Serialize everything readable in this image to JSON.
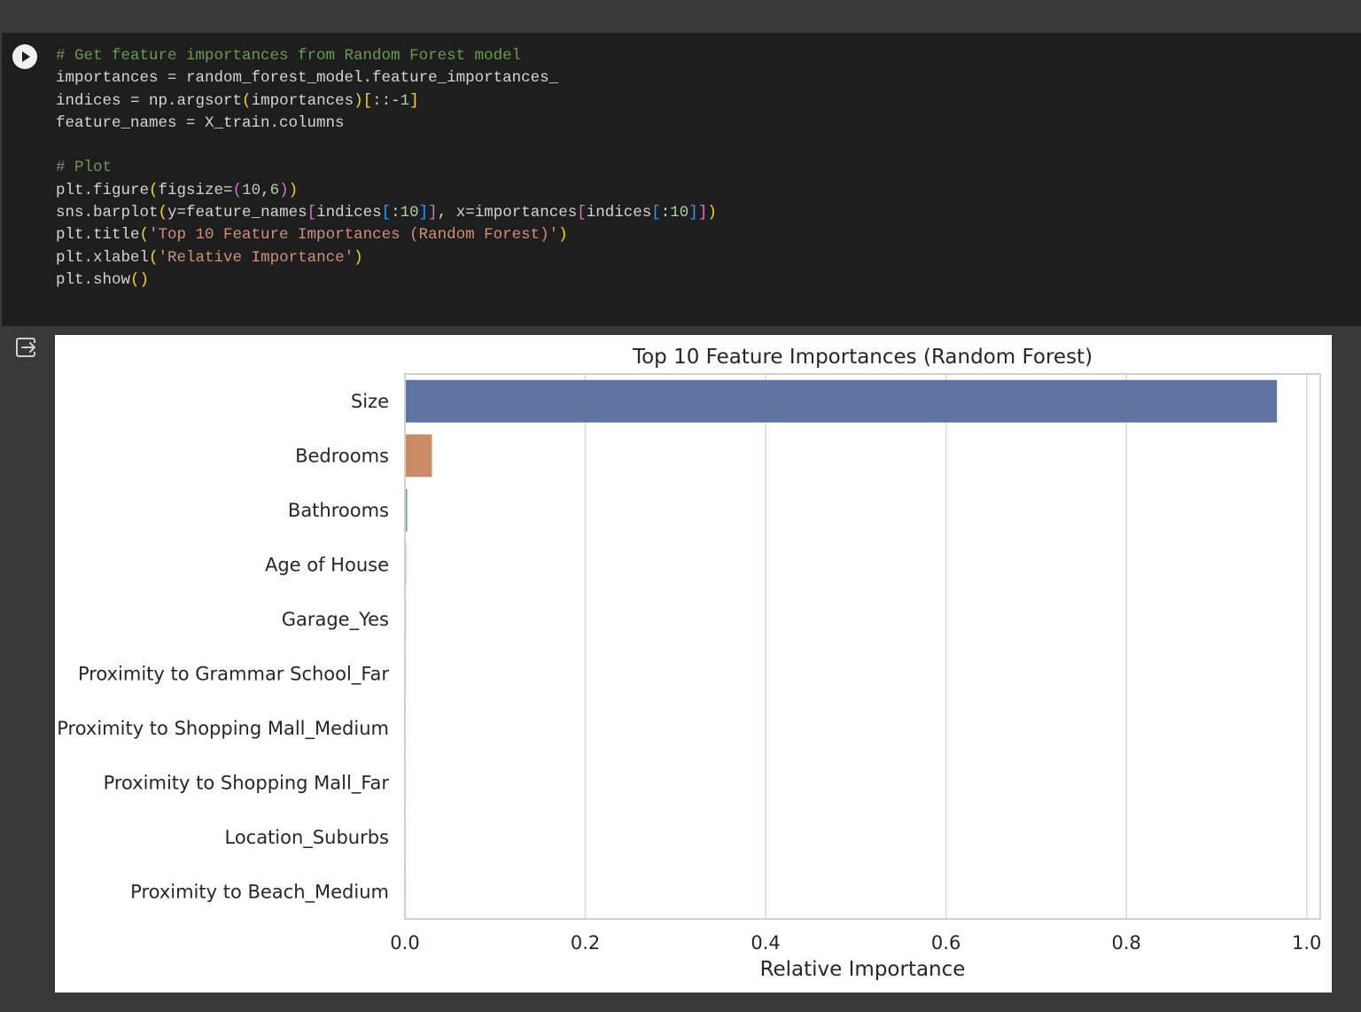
{
  "code_cell": {
    "run_icon": "play-circle-icon",
    "lines": [
      [
        {
          "t": "# Get feature importances from Random Forest model",
          "c": "t-comment"
        }
      ],
      [
        {
          "t": "importances = random_forest_model.feature_importances_",
          "c": ""
        }
      ],
      [
        {
          "t": "indices = np.argsort",
          "c": ""
        },
        {
          "t": "(",
          "c": "t-p1"
        },
        {
          "t": "importances",
          "c": ""
        },
        {
          "t": ")",
          "c": "t-p1"
        },
        {
          "t": "[",
          "c": "t-p1"
        },
        {
          "t": "::-",
          "c": ""
        },
        {
          "t": "1",
          "c": "t-num"
        },
        {
          "t": "]",
          "c": "t-p1"
        }
      ],
      [
        {
          "t": "feature_names = X_train.columns",
          "c": ""
        }
      ],
      [
        {
          "t": "",
          "c": ""
        }
      ],
      [
        {
          "t": "# Plot",
          "c": "t-comment"
        }
      ],
      [
        {
          "t": "plt.figure",
          "c": ""
        },
        {
          "t": "(",
          "c": "t-p1"
        },
        {
          "t": "figsize=",
          "c": ""
        },
        {
          "t": "(",
          "c": "t-p2"
        },
        {
          "t": "10",
          "c": "t-num"
        },
        {
          "t": ",",
          "c": ""
        },
        {
          "t": "6",
          "c": "t-num"
        },
        {
          "t": ")",
          "c": "t-p2"
        },
        {
          "t": ")",
          "c": "t-p1"
        }
      ],
      [
        {
          "t": "sns.barplot",
          "c": ""
        },
        {
          "t": "(",
          "c": "t-p1"
        },
        {
          "t": "y=feature_names",
          "c": ""
        },
        {
          "t": "[",
          "c": "t-p2"
        },
        {
          "t": "indices",
          "c": ""
        },
        {
          "t": "[",
          "c": "t-p3"
        },
        {
          "t": ":",
          "c": ""
        },
        {
          "t": "10",
          "c": "t-num"
        },
        {
          "t": "]",
          "c": "t-p3"
        },
        {
          "t": "]",
          "c": "t-p2"
        },
        {
          "t": ", x=importances",
          "c": ""
        },
        {
          "t": "[",
          "c": "t-p2"
        },
        {
          "t": "indices",
          "c": ""
        },
        {
          "t": "[",
          "c": "t-p3"
        },
        {
          "t": ":",
          "c": ""
        },
        {
          "t": "10",
          "c": "t-num"
        },
        {
          "t": "]",
          "c": "t-p3"
        },
        {
          "t": "]",
          "c": "t-p2"
        },
        {
          "t": ")",
          "c": "t-p1"
        }
      ],
      [
        {
          "t": "plt.title",
          "c": ""
        },
        {
          "t": "(",
          "c": "t-p1"
        },
        {
          "t": "'Top 10 Feature Importances (Random Forest)'",
          "c": "t-str"
        },
        {
          "t": ")",
          "c": "t-p1"
        }
      ],
      [
        {
          "t": "plt.xlabel",
          "c": ""
        },
        {
          "t": "(",
          "c": "t-p1"
        },
        {
          "t": "'Relative Importance'",
          "c": "t-str"
        },
        {
          "t": ")",
          "c": "t-p1"
        }
      ],
      [
        {
          "t": "plt.show",
          "c": ""
        },
        {
          "t": "()",
          "c": "t-p1"
        }
      ]
    ]
  },
  "output": {
    "icon": "output-redirect-icon"
  },
  "chart_data": {
    "type": "bar",
    "orientation": "horizontal",
    "title": "Top 10 Feature Importances (Random Forest)",
    "xlabel": "Relative Importance",
    "ylabel": "",
    "xlim": [
      0.0,
      1.015
    ],
    "xticks": [
      "0.0",
      "0.2",
      "0.4",
      "0.6",
      "0.8",
      "1.0"
    ],
    "grid": "vertical",
    "categories": [
      "Size",
      "Bedrooms",
      "Bathrooms",
      "Age of House",
      "Garage_Yes",
      "Proximity to Grammar School_Far",
      "Proximity to Shopping Mall_Medium",
      "Proximity to Shopping Mall_Far",
      "Location_Suburbs",
      "Proximity to Beach_Medium"
    ],
    "values": [
      0.966,
      0.029,
      0.0015,
      0.0003,
      0.0002,
      0.0001,
      0.0001,
      0.0001,
      0.0001,
      0.0001
    ],
    "colors": [
      "#5f74a3",
      "#c98c66",
      "#6aa474",
      "#b55d60",
      "#857aab",
      "#8d7866",
      "#d095bf",
      "#8c8c8c",
      "#c1b37f",
      "#6fb0c9"
    ]
  }
}
